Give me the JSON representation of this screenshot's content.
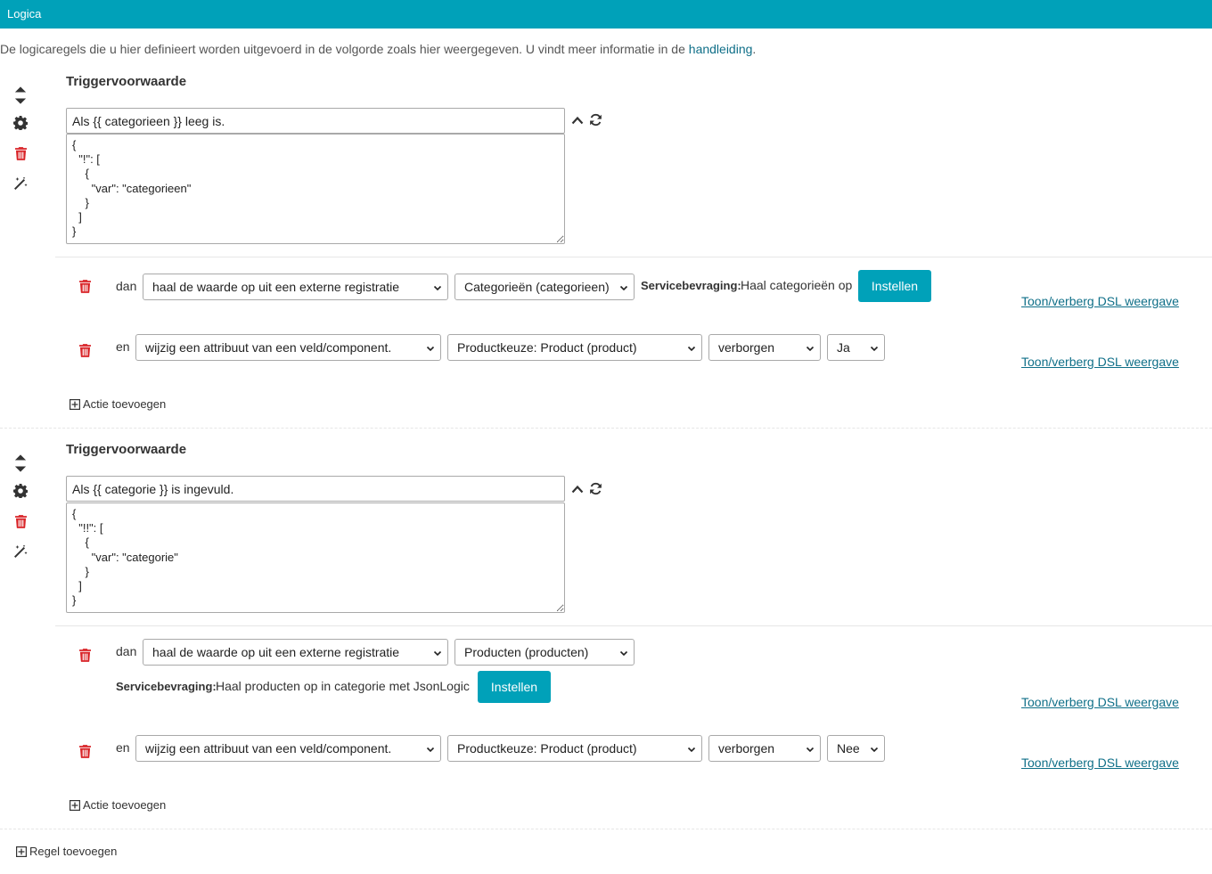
{
  "header": {
    "title": "Logica"
  },
  "intro": {
    "text": "De logicaregels die u hier definieert worden uitgevoerd in de volgorde zoals hier weergegeven. U vindt meer informatie in de ",
    "link": "handleiding",
    "suffix": "."
  },
  "rules": [
    {
      "heading": "Triggervoorwaarde",
      "description": "Als {{ categorieen }} leeg is.",
      "json": "{\n  \"!\": [\n    {\n      \"var\": \"categorieen\"\n    }\n  ]\n}",
      "actions": [
        {
          "connector": "dan",
          "action_type": "haal de waarde op uit een externe registratie",
          "target": "Categorieën (categorieen)",
          "service_label": "Servicebevraging:",
          "service_value": "Haal categorieën op",
          "button": "Instellen",
          "dsl_link": "Toon/verberg DSL weergave"
        },
        {
          "connector": "en",
          "action_type": "wijzig een attribuut van een veld/component.",
          "component": "Productkeuze: Product (product)",
          "attribute": "verborgen",
          "value": "Ja",
          "dsl_link": "Toon/verberg DSL weergave"
        }
      ],
      "add_action": "Actie toevoegen"
    },
    {
      "heading": "Triggervoorwaarde",
      "description": "Als {{ categorie }} is ingevuld.",
      "json": "{\n  \"!!\": [\n    {\n      \"var\": \"categorie\"\n    }\n  ]\n}",
      "actions": [
        {
          "connector": "dan",
          "action_type": "haal de waarde op uit een externe registratie",
          "target": "Producten (producten)",
          "service_label": "Servicebevraging:",
          "service_value": "Haal producten op in categorie met JsonLogic",
          "button": "Instellen",
          "dsl_link": "Toon/verberg DSL weergave"
        },
        {
          "connector": "en",
          "action_type": "wijzig een attribuut van een veld/component.",
          "component": "Productkeuze: Product (product)",
          "attribute": "verborgen",
          "value": "Nee",
          "dsl_link": "Toon/verberg DSL weergave"
        }
      ],
      "add_action": "Actie toevoegen"
    }
  ],
  "add_rule": "Regel toevoegen",
  "icons": {
    "sort": "sort-icon",
    "settings": "gear-icon",
    "delete": "trash-icon",
    "magic": "magic-wand-icon",
    "collapse": "chevron-up-icon",
    "refresh": "refresh-icon",
    "dropdown": "chevron-down-icon",
    "add": "plus-square-icon"
  },
  "colors": {
    "header": "#00a1b9",
    "button": "#00a1b9",
    "link": "#0f6f88",
    "danger": "#d9262a"
  }
}
